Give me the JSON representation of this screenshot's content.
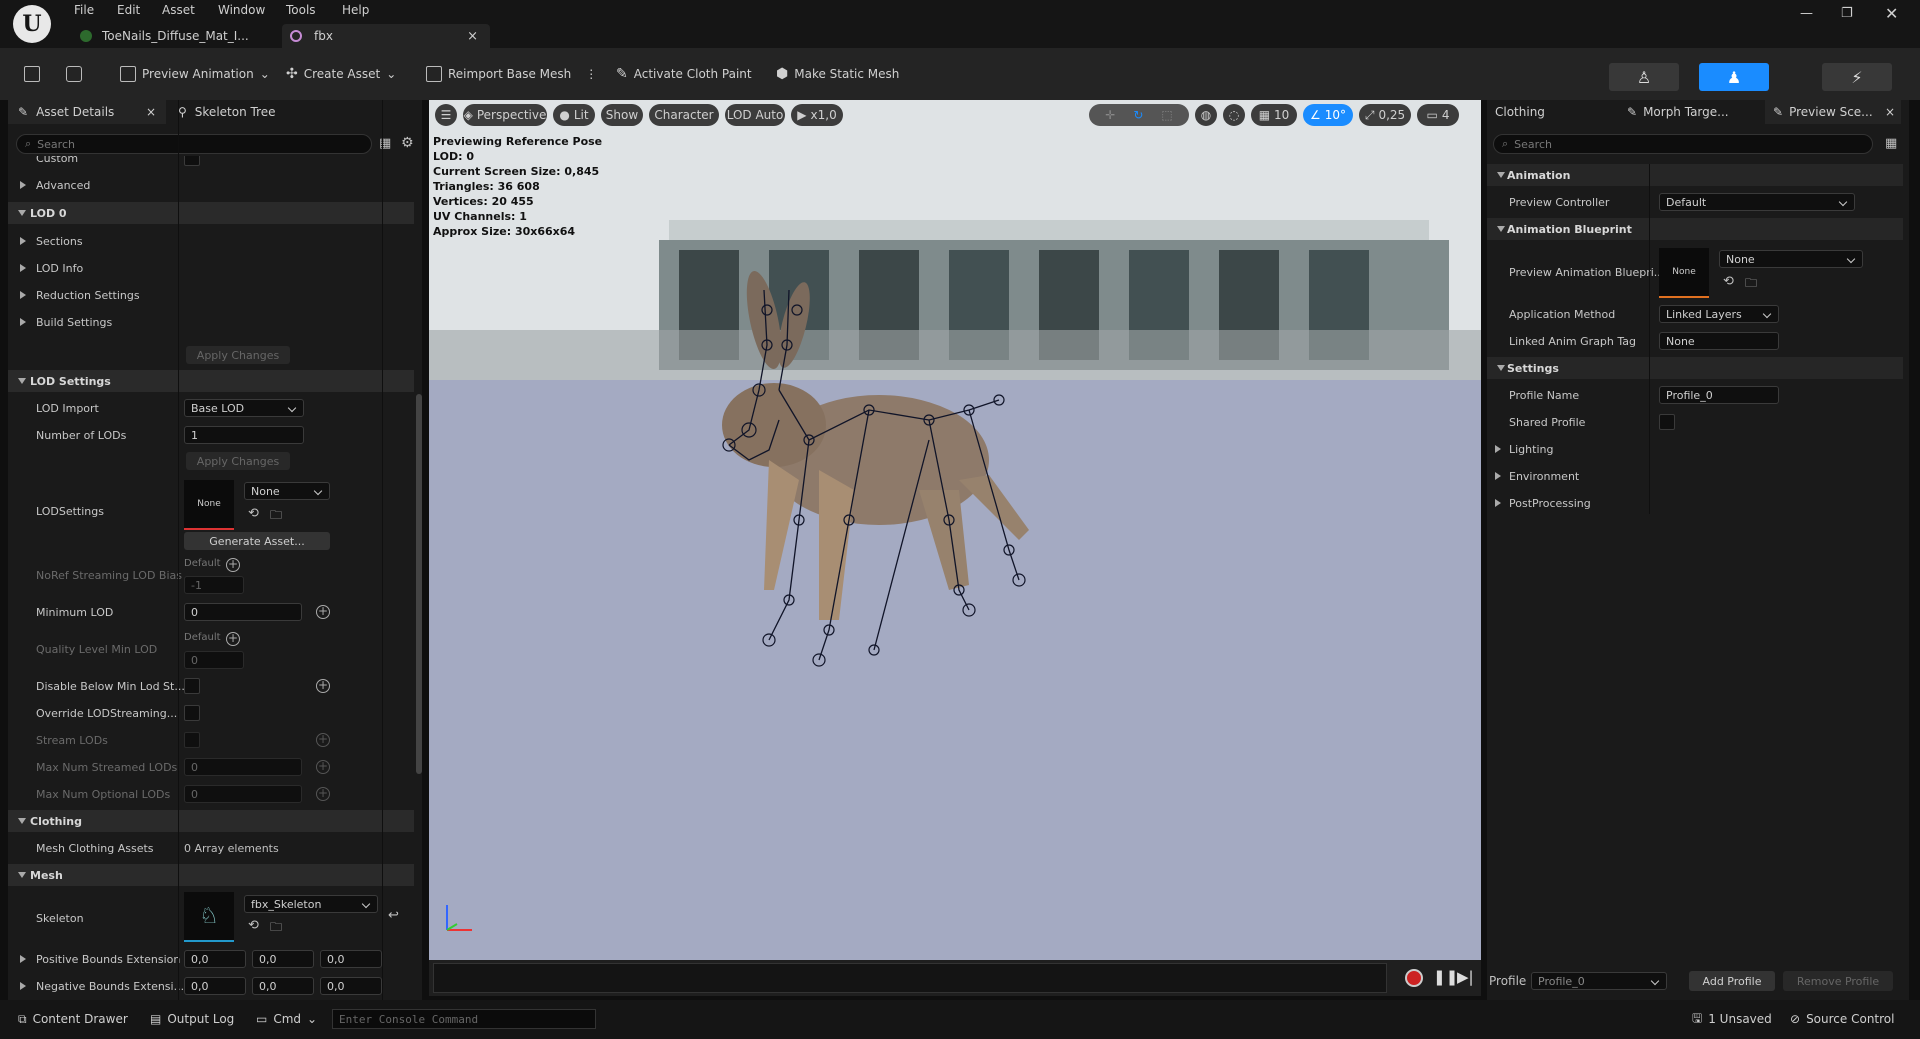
{
  "menu": [
    "File",
    "Edit",
    "Asset",
    "Window",
    "Tools",
    "Help"
  ],
  "tabs": [
    {
      "label": "ToeNails_Diffuse_Mat_I..."
    },
    {
      "label": "fbx"
    }
  ],
  "toolbar": {
    "preview_animation": "Preview Animation",
    "create_asset": "Create Asset",
    "reimport": "Reimport Base Mesh",
    "cloth_paint": "Activate Cloth Paint",
    "static_mesh": "Make Static Mesh"
  },
  "left": {
    "tab_asset": "Asset Details",
    "tab_skeleton": "Skeleton Tree",
    "search_placeholder": "Search",
    "custom": "Custom",
    "advanced": "Advanced",
    "lod0": "LOD 0",
    "sections": "Sections",
    "lod_info": "LOD Info",
    "reduction": "Reduction Settings",
    "build": "Build Settings",
    "apply_changes": "Apply Changes",
    "lod_settings": "LOD Settings",
    "lod_import": "LOD Import",
    "lod_import_val": "Base LOD",
    "num_lods": "Number of LODs",
    "num_lods_val": "1",
    "lodsettings": "LODSettings",
    "lodsettings_thumb": "None",
    "lodsettings_val": "None",
    "generate": "Generate Asset...",
    "noref": "NoRef Streaming LOD Bias",
    "default": "Default",
    "noref_val": "-1",
    "min_lod": "Minimum LOD",
    "min_lod_val": "0",
    "quality": "Quality Level Min LOD",
    "quality_val": "0",
    "disable_below": "Disable Below Min Lod St...",
    "override": "Override LODStreaming...",
    "stream_lods": "Stream LODs",
    "max_streamed": "Max Num Streamed LODs",
    "max_streamed_val": "0",
    "max_optional": "Max Num Optional LODs",
    "max_optional_val": "0",
    "clothing": "Clothing",
    "mesh_clothing": "Mesh Clothing Assets",
    "mesh_clothing_val": "0 Array elements",
    "mesh": "Mesh",
    "skeleton": "Skeleton",
    "skeleton_val": "fbx_Skeleton",
    "pos_bounds": "Positive Bounds Extension",
    "neg_bounds": "Negative Bounds Extensi...",
    "bounds_vals": [
      "0,0",
      "0,0",
      "0,0"
    ]
  },
  "viewport": {
    "perspective": "Perspective",
    "lit": "Lit",
    "show": "Show",
    "character": "Character",
    "lod_auto": "LOD Auto",
    "speed": "x1,0",
    "grid": "10",
    "angle": "10°",
    "scale": "0,25",
    "camera": "4",
    "overlay": [
      "Previewing Reference Pose",
      "LOD: 0",
      "Current Screen Size: 0,845",
      "Triangles: 36 608",
      "Vertices: 20 455",
      "UV Channels: 1",
      "Approx Size: 30x66x64"
    ]
  },
  "right": {
    "tab_clothing": "Clothing",
    "tab_morph": "Morph Targe...",
    "tab_preview": "Preview Sce...",
    "search_placeholder": "Search",
    "animation": "Animation",
    "preview_controller": "Preview Controller",
    "preview_controller_val": "Default",
    "anim_bp": "Animation Blueprint",
    "preview_anim_bp": "Preview Animation Bluepri...",
    "anim_bp_thumb": "None",
    "anim_bp_val": "None",
    "app_method": "Application Method",
    "app_method_val": "Linked Layers",
    "linked_tag": "Linked Anim Graph Tag",
    "linked_tag_val": "None",
    "settings": "Settings",
    "profile_name": "Profile Name",
    "profile_name_val": "Profile_0",
    "shared_profile": "Shared Profile",
    "lighting": "Lighting",
    "environment": "Environment",
    "postprocessing": "PostProcessing",
    "profile_label": "Profile",
    "profile_dd": "Profile_0",
    "add_profile": "Add Profile",
    "remove_profile": "Remove Profile"
  },
  "bottom": {
    "content_drawer": "Content Drawer",
    "output_log": "Output Log",
    "cmd": "Cmd",
    "console_placeholder": "Enter Console Command",
    "unsaved": "1 Unsaved",
    "source_control": "Source Control"
  },
  "colors": {
    "accent": "#0070e0",
    "selected_tab": "#1a8cff"
  }
}
